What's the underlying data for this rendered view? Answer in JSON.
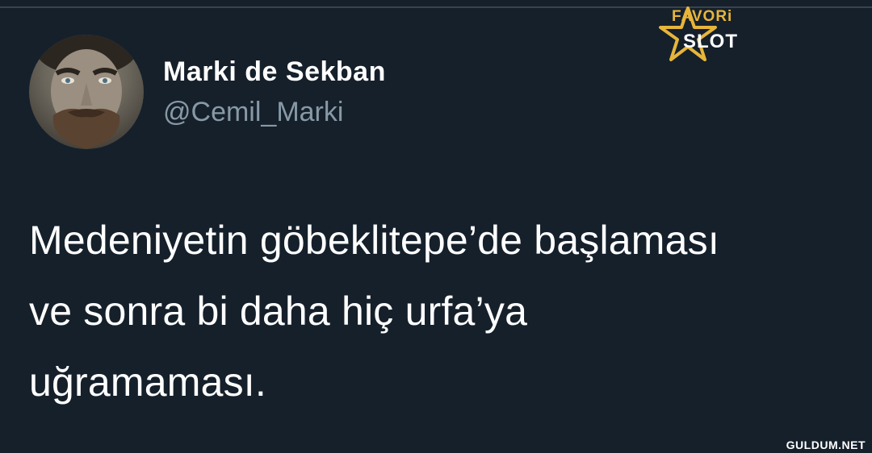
{
  "tweet": {
    "display_name": "Marki de Sekban",
    "handle": "@Cemil_Marki",
    "text_lines": [
      "Medeniyetin göbeklitepe’de başlaması",
      "ve sonra bi daha hiç urfa’ya",
      "uğramaması."
    ],
    "avatar_icon": "profile-photo"
  },
  "logo": {
    "line1": "FAVORi",
    "line2": "SLOT",
    "accent_color": "#e7b53a",
    "icon": "star-icon"
  },
  "watermark": "GULDUM.NET",
  "colors": {
    "background": "#15202b",
    "text": "#ffffff",
    "secondary_text": "#8899a6"
  }
}
